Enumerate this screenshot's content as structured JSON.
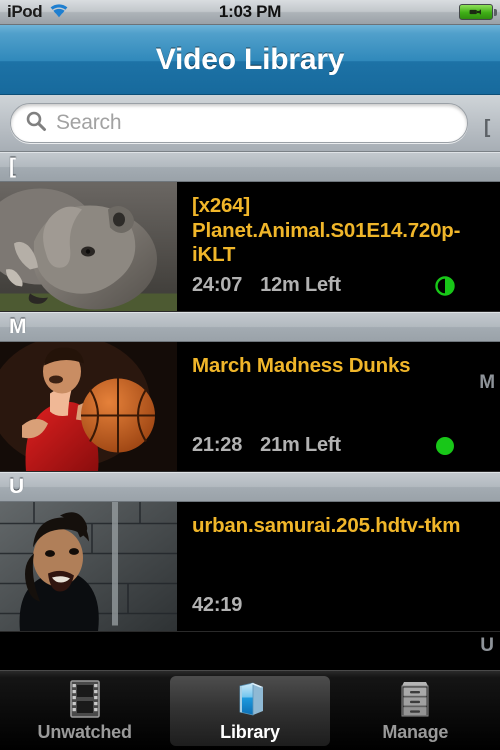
{
  "status_bar": {
    "carrier": "iPod",
    "wifi_icon": "wifi-icon",
    "time": "1:03 PM",
    "battery_icon": "battery-charging-icon"
  },
  "nav": {
    "title": "Video Library"
  },
  "search": {
    "icon": "search-icon",
    "placeholder": "Search",
    "value": ""
  },
  "index_bar": {
    "letters": [
      "[",
      "M",
      "U"
    ]
  },
  "sections": [
    {
      "header": "[",
      "rows": [
        {
          "title": "[x264] Planet.Animal.S01E14.720p-iKLT",
          "duration": "24:07",
          "remaining": "12m Left",
          "status": "half",
          "status_color": "#18c718",
          "thumbnail": "rhinoceros-thumbnail"
        }
      ]
    },
    {
      "header": "M",
      "rows": [
        {
          "title": "March Madness Dunks",
          "duration": "21:28",
          "remaining": "21m Left",
          "status": "full",
          "status_color": "#18c718",
          "thumbnail": "basketball-player-thumbnail"
        }
      ]
    },
    {
      "header": "U",
      "rows": [
        {
          "title": "urban.samurai.205.hdtv-tkm",
          "duration": "42:19",
          "remaining": "",
          "status": "none",
          "status_color": "",
          "thumbnail": "samurai-man-thumbnail"
        }
      ]
    }
  ],
  "tabs": [
    {
      "label": "Unwatched",
      "icon": "film-strip-icon",
      "active": false
    },
    {
      "label": "Library",
      "icon": "book-icon",
      "active": true
    },
    {
      "label": "Manage",
      "icon": "file-cabinet-icon",
      "active": false
    }
  ],
  "colors": {
    "title_gold": "#f0b62a",
    "meta_gray": "#b2b2b2",
    "nav_blue_top": "#6fb4d8",
    "nav_blue_bottom": "#176a9d",
    "status_green": "#18c718",
    "background": "#000000"
  }
}
